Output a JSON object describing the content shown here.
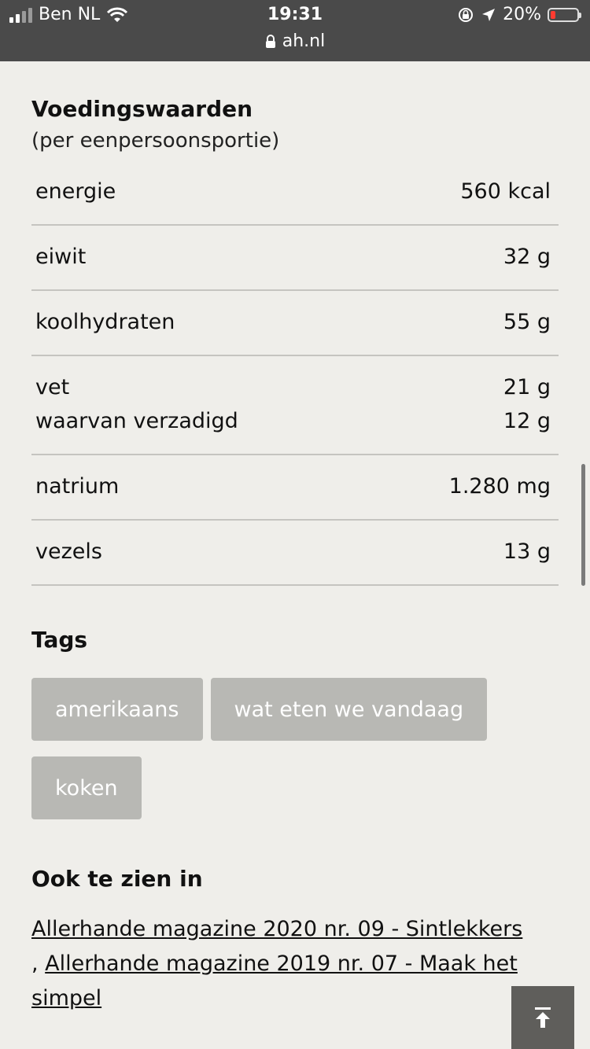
{
  "status_bar": {
    "carrier": "Ben NL",
    "time": "19:31",
    "url": "ah.nl",
    "battery": "20%"
  },
  "nutrition": {
    "title": "Voedingswaarden",
    "subtitle": "(per eenpersoonsportie)",
    "rows": [
      {
        "lines": [
          {
            "label": "energie",
            "value": "560 kcal"
          }
        ]
      },
      {
        "lines": [
          {
            "label": "eiwit",
            "value": "32 g"
          }
        ]
      },
      {
        "lines": [
          {
            "label": "koolhydraten",
            "value": "55 g"
          }
        ]
      },
      {
        "lines": [
          {
            "label": "vet",
            "value": "21 g"
          },
          {
            "label": "waarvan verzadigd",
            "value": "12 g"
          }
        ]
      },
      {
        "lines": [
          {
            "label": "natrium",
            "value": "1.280 mg"
          }
        ]
      },
      {
        "lines": [
          {
            "label": "vezels",
            "value": "13 g"
          }
        ]
      }
    ]
  },
  "tags": {
    "title": "Tags",
    "items": [
      "amerikaans",
      "wat eten we vandaag",
      "koken"
    ]
  },
  "also_in": {
    "title": "Ook te zien in",
    "separator": ", ",
    "links": [
      "Allerhande magazine 2020 nr. 09 - Sintlekkers",
      "Allerhande magazine 2019 nr. 07 - Maak het simpel"
    ]
  },
  "icons": {
    "back_to_top": "arrow-up-to-line-icon",
    "lock": "lock-icon",
    "wifi": "wifi-icon",
    "location": "location-arrow-icon",
    "rotation_lock": "rotation-lock-icon"
  },
  "colors": {
    "background": "#efeeea",
    "status_bar": "#4a4a4a",
    "tag_bg": "#b8b8b4",
    "back_to_top_bg": "#5f5e5b",
    "battery_low": "#ff3b30"
  }
}
